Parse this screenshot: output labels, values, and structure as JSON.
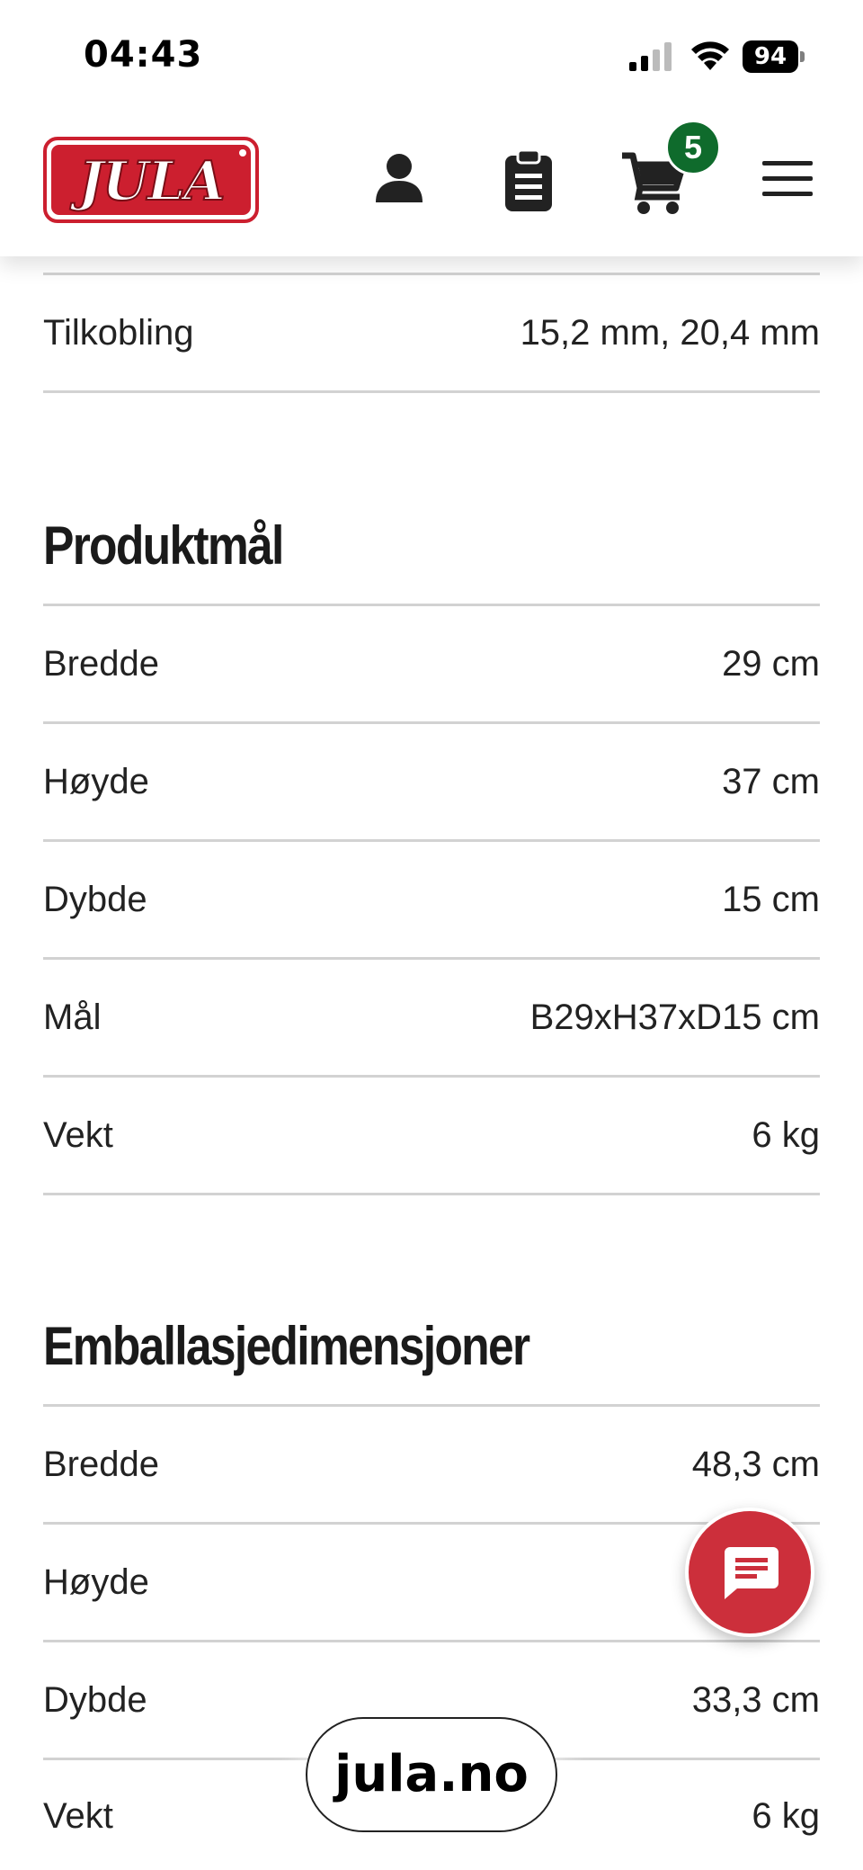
{
  "status_bar": {
    "time": "04:43",
    "battery_level": "94",
    "icons": [
      "signal-icon",
      "wifi-icon",
      "battery-icon"
    ]
  },
  "header": {
    "logo_text": "JULA",
    "cart_count": "5",
    "colors": {
      "logo_red": "#cc1f2f",
      "badge_green": "#0f6b2c"
    },
    "icons": [
      "account-icon",
      "clipboard-icon",
      "cart-icon",
      "menu-icon"
    ]
  },
  "specs": {
    "tilkobling": {
      "label": "Tilkobling",
      "value": "15,2 mm, 20,4 mm"
    },
    "produktmal": {
      "title": "Produktmål",
      "rows": [
        {
          "label": "Bredde",
          "value": "29 cm"
        },
        {
          "label": "Høyde",
          "value": "37 cm"
        },
        {
          "label": "Dybde",
          "value": "15 cm"
        },
        {
          "label": "Mål",
          "value": "B29xH37xD15 cm"
        },
        {
          "label": "Vekt",
          "value": "6 kg"
        }
      ]
    },
    "emballasje": {
      "title": "Emballasjedimensjoner",
      "rows": [
        {
          "label": "Bredde",
          "value": "48,3 cm"
        },
        {
          "label": "Høyde",
          "value": ""
        },
        {
          "label": "Dybde",
          "value": "33,3 cm"
        },
        {
          "label": "Vekt",
          "value": "6 kg"
        }
      ]
    }
  },
  "chat": {
    "icon": "chat-icon",
    "color": "#cc2f3b"
  },
  "browser": {
    "url": "jula.no"
  }
}
